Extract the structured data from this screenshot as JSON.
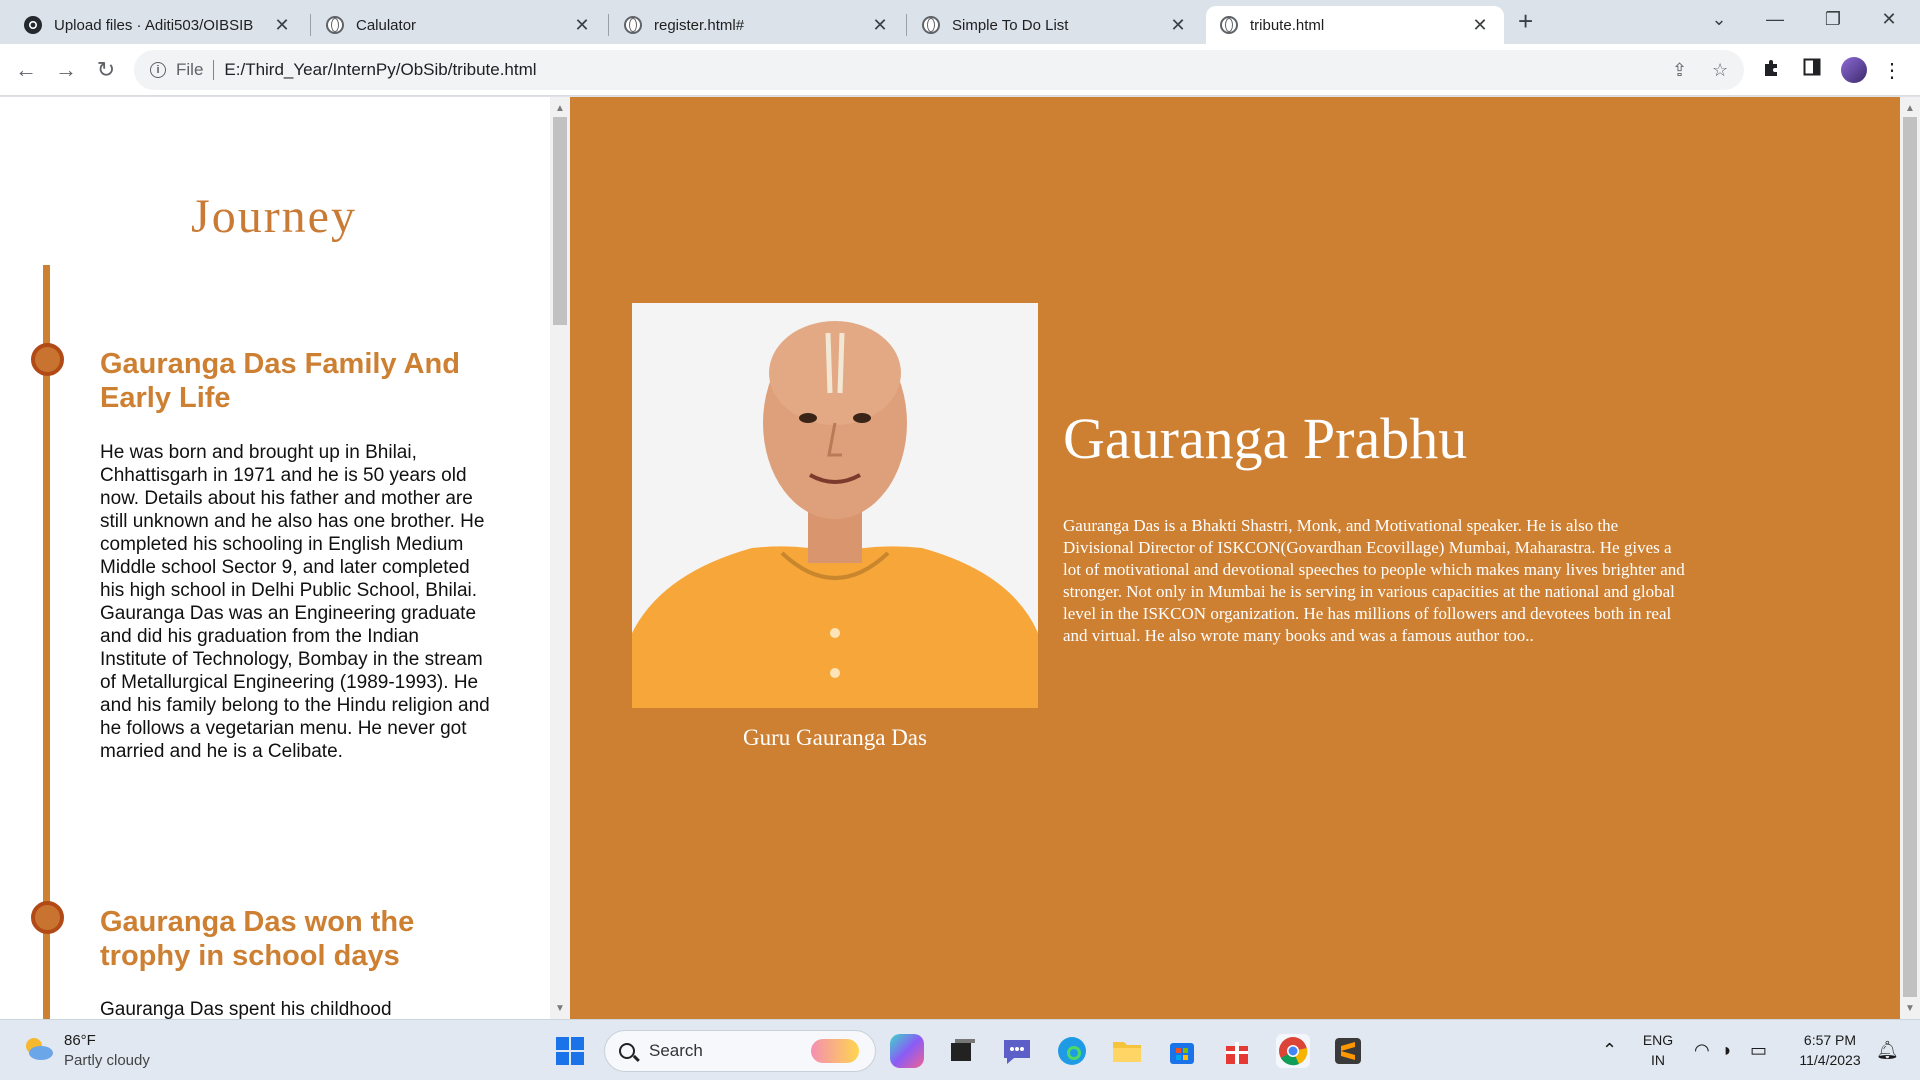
{
  "browser": {
    "tabs": [
      {
        "label": "Upload files · Aditi503/OIBSIB",
        "close": "✕",
        "favicon": "github-icon"
      },
      {
        "label": "Calulator",
        "close": "✕",
        "favicon": "globe-icon"
      },
      {
        "label": "register.html#",
        "close": "✕",
        "favicon": "globe-icon"
      },
      {
        "label": "Simple To Do List",
        "close": "✕",
        "favicon": "globe-icon"
      },
      {
        "label": "tribute.html",
        "close": "✕",
        "favicon": "globe-icon",
        "active": true
      }
    ],
    "new_tab": "+",
    "address": {
      "scheme_label": "File",
      "url": "E:/Third_Year/InternPy/ObSib/tribute.html"
    }
  },
  "journey": {
    "title": "Journey",
    "events": [
      {
        "title": "Gauranga Das Family And Early Life",
        "text": "He was born and brought up in Bhilai, Chhattisgarh in 1971 and he is 50 years old now. Details about his father and mother are still unknown and he also has one brother. He completed his schooling in English Medium Middle school Sector 9, and later completed his high school in Delhi Public School, Bhilai. Gauranga Das was an Engineering graduate and did his graduation from the Indian Institute of Technology, Bombay in the stream of Metallurgical Engineering (1989-1993). He and his family belong to the Hindu religion and he follows a vegetarian menu. He never got married and he is a Celibate."
      },
      {
        "title": "Gauranga Das won the trophy in school days",
        "text": "Gauranga Das spent his childhood"
      }
    ]
  },
  "tribute": {
    "caption": "Guru Gauranga Das",
    "name": "Gauranga Prabhu",
    "bio": "Gauranga Das is a Bhakti Shastri, Monk, and Motivational speaker. He is also the Divisional Director of ISKCON(Govardhan Ecovillage) Mumbai, Maharastra. He gives a lot of motivational and devotional speeches to people which makes many lives brighter and stronger. Not only in Mumbai he is serving in various capacities at the national and global level in the ISKCON organization. He has millions of followers and devotees both in real and virtual. He also wrote many books and was a famous author too.."
  },
  "taskbar": {
    "weather": {
      "temp": "86°F",
      "desc": "Partly cloudy"
    },
    "search_label": "Search",
    "lang_top": "ENG",
    "lang_bottom": "IN",
    "time": "6:57 PM",
    "date": "11/4/2023"
  },
  "colors": {
    "accent": "#cd7f32",
    "timeline_dot_border": "#b24a18"
  }
}
